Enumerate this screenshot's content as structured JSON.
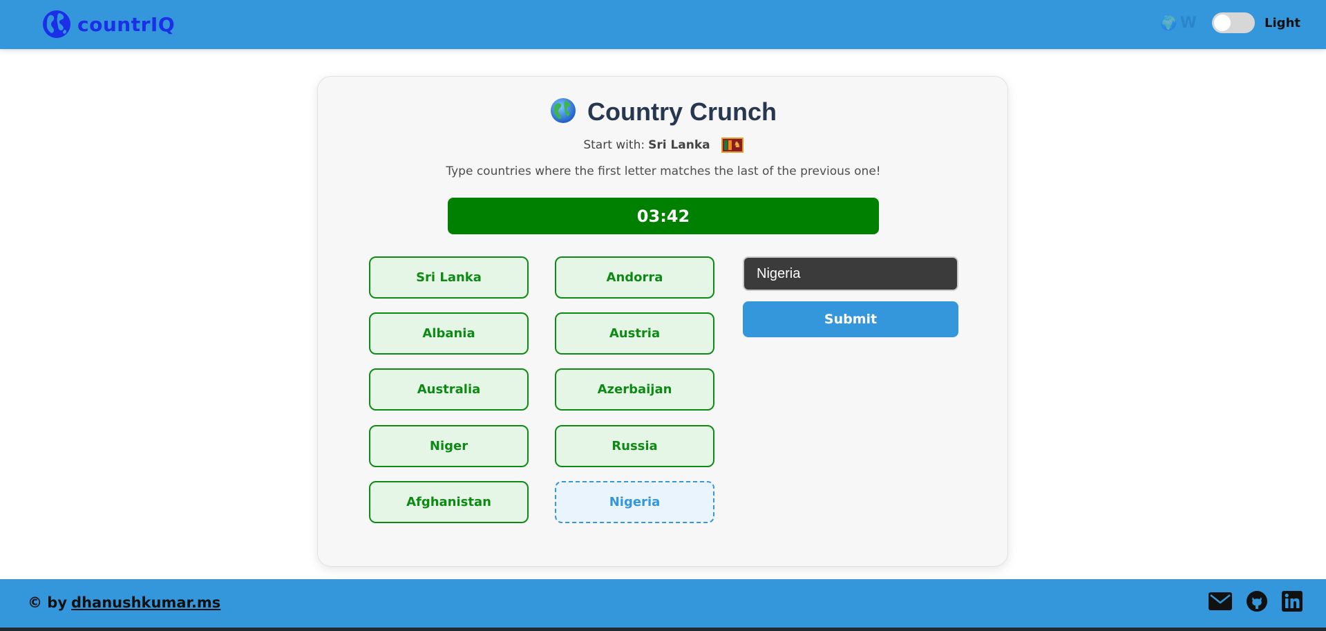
{
  "navbar": {
    "brand": "countrIQ",
    "weather_text": "W",
    "theme_label": "Light",
    "theme_toggle_on": false
  },
  "game": {
    "title": "Country Crunch",
    "start_prefix": "Start with:",
    "start_country": "Sri Lanka",
    "instructions": "Type countries where the first letter matches the last of the previous one!",
    "timer": "03:42",
    "chain": [
      "Sri Lanka",
      "Andorra",
      "Albania",
      "Austria",
      "Australia",
      "Azerbaijan",
      "Niger",
      "Russia",
      "Afghanistan"
    ],
    "pending": "Nigeria",
    "input_value": "Nigeria",
    "submit_label": "Submit"
  },
  "footer": {
    "credit_prefix": "© by",
    "credit_link": "dhanushkumar.ms"
  },
  "colors": {
    "primary": "#3597db",
    "success": "#008000",
    "brand": "#1a2fe6"
  }
}
